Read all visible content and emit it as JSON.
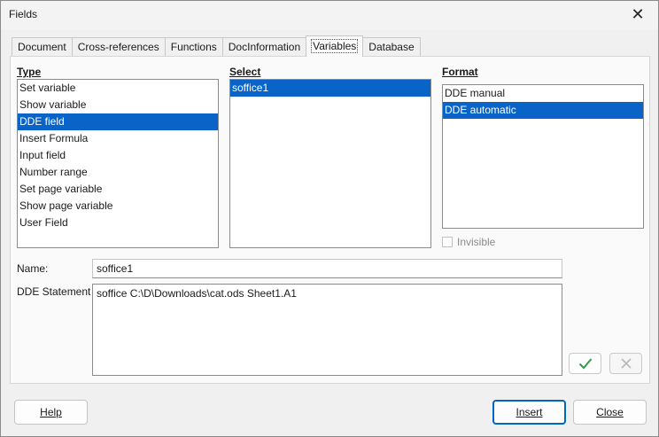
{
  "window": {
    "title": "Fields"
  },
  "tabs": [
    {
      "label": "Document"
    },
    {
      "label": "Cross-references"
    },
    {
      "label": "Functions"
    },
    {
      "label": "DocInformation"
    },
    {
      "label": "Variables"
    },
    {
      "label": "Database"
    }
  ],
  "type": {
    "heading": "Type",
    "items": [
      "Set variable",
      "Show variable",
      "DDE field",
      "Insert Formula",
      "Input field",
      "Number range",
      "Set page variable",
      "Show page variable",
      "User Field"
    ],
    "selected": "DDE field"
  },
  "select": {
    "heading": "Select",
    "items": [
      "soffice1"
    ],
    "selected": "soffice1"
  },
  "format": {
    "heading": "Format",
    "items": [
      "DDE manual",
      "DDE automatic"
    ],
    "selected": "DDE automatic",
    "invisible_label": "Invisible"
  },
  "name": {
    "label": "Name:",
    "value": "soffice1"
  },
  "dde_statement": {
    "label": "DDE Statement",
    "value": "soffice C:\\D\\Downloads\\cat.ods Sheet1.A1"
  },
  "icons": {
    "apply": "checkmark-icon",
    "delete": "x-mark-icon",
    "colors": {
      "apply": "#2e9e48",
      "delete_disabled": "#b8b8b8"
    }
  },
  "buttons": {
    "help": "Help",
    "insert": "Insert",
    "close": "Close"
  },
  "colors": {
    "selection": "#0a64c8",
    "default_button_border": "#0067c0"
  }
}
